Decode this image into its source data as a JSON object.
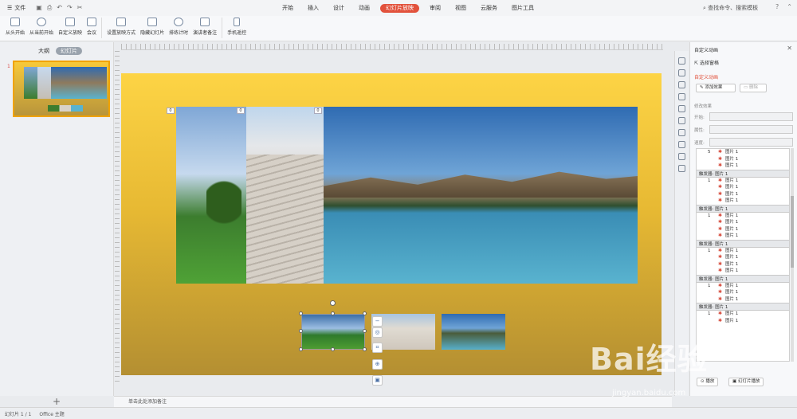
{
  "titlebar": {
    "file_label": "文件",
    "tabs": [
      "开始",
      "插入",
      "设计",
      "动画",
      "幻灯片放映",
      "审阅",
      "视图",
      "云服务",
      "图片工具"
    ],
    "active_tab": "幻灯片放映",
    "search": "查找命令、搜索模板"
  },
  "ribbon": {
    "buttons": [
      "从头开始",
      "从当前开始",
      "自定义放映",
      "会议",
      "设置放映方式",
      "隐藏幻灯片",
      "排练计时",
      "演讲者备注",
      "手机遥控"
    ]
  },
  "left_pane": {
    "tab_outline": "大纲",
    "tab_slides": "幻灯片",
    "slide_number": "1",
    "add": "+"
  },
  "canvas": {
    "badge": "0"
  },
  "notes": {
    "placeholder": "单击此处添加备注"
  },
  "status": {
    "slide": "幻灯片 1 / 1",
    "theme": "Office 主题"
  },
  "right_panel": {
    "title": "自定义动画",
    "select_pane": "选择窗格",
    "section": "自定义动画",
    "add_effect": "添加效果",
    "delete": "删除",
    "modify": "修改效果",
    "start_label": "开始:",
    "prop_label": "属性:",
    "speed_label": "速度:",
    "item_label": "图片 1",
    "trigger_label": "触发器: 图片 1",
    "play": "播放",
    "slideshow": "幻灯片播放"
  },
  "colors": {
    "accent": "#e2523c",
    "selection": "#f0a300"
  }
}
